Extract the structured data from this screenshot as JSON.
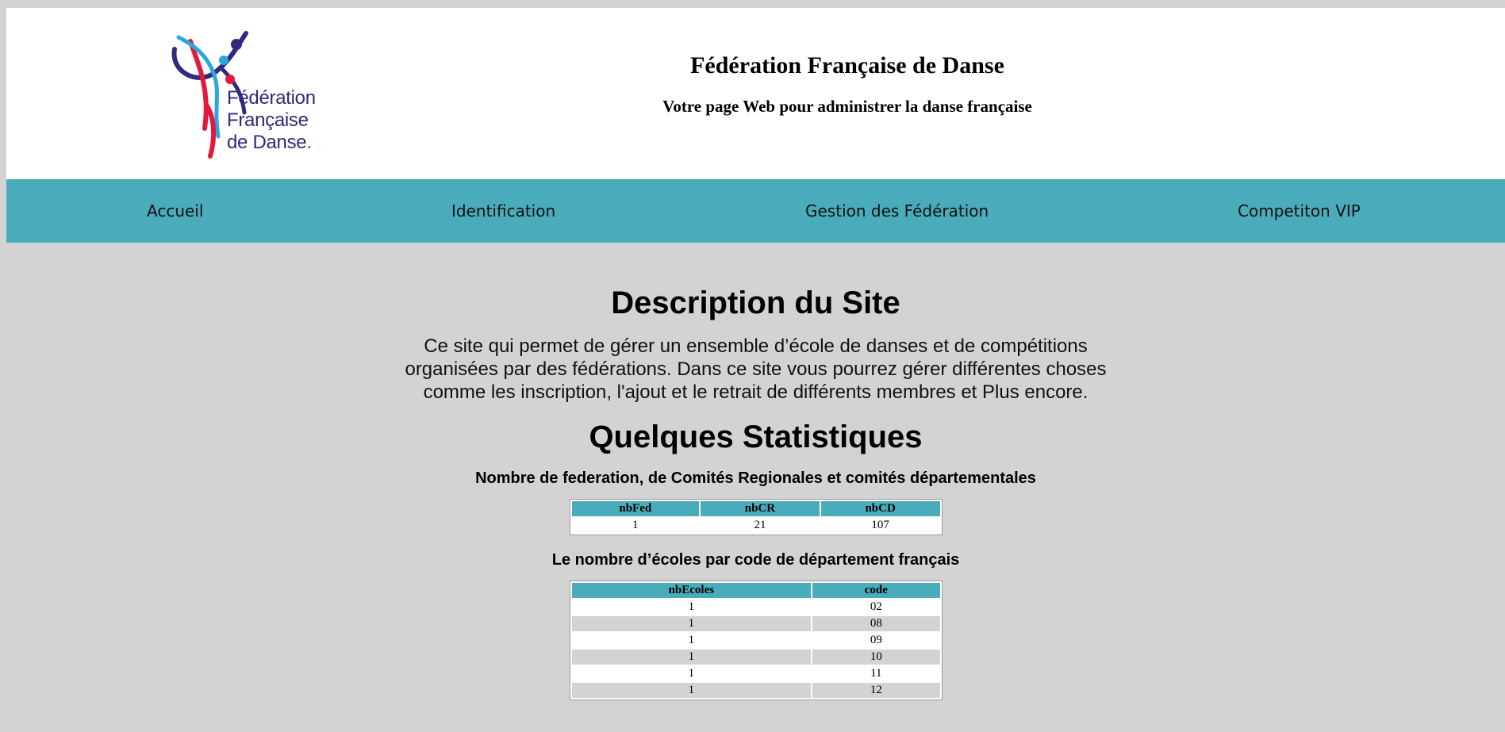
{
  "header": {
    "logo_lines": [
      "Fédération",
      "Française",
      "de Danse"
    ],
    "logo_dot": ".",
    "title": "Fédération Française de Danse",
    "subtitle": "Votre page Web pour administrer la danse française"
  },
  "nav": {
    "items": [
      "Accueil",
      "Identification",
      "Gestion des Fédération",
      "Competiton VIP"
    ]
  },
  "colors": {
    "nav_bg": "#4aabba",
    "page_bg": "#d3d3d3",
    "logo_blue": "#2e2a7c",
    "logo_red": "#e4173c",
    "logo_cyan": "#29a8e0"
  },
  "description": {
    "title": "Description du Site",
    "text": "Ce site qui permet de gérer un ensemble d’école de danses et de compétitions organisées par des fédérations. Dans ce site vous pourrez gérer différentes choses comme les inscription, l'ajout et le retrait de différents membres et Plus encore."
  },
  "stats": {
    "title": "Quelques Statistiques",
    "table1": {
      "caption": "Nombre de federation, de Comités Regionales et comités départementales",
      "headers": [
        "nbFed",
        "nbCR",
        "nbCD"
      ],
      "rows": [
        [
          "1",
          "21",
          "107"
        ]
      ]
    },
    "table2": {
      "caption": "Le nombre d’écoles par code de département français",
      "headers": [
        "nbEcoles",
        "code"
      ],
      "rows": [
        [
          "1",
          "02"
        ],
        [
          "1",
          "08"
        ],
        [
          "1",
          "09"
        ],
        [
          "1",
          "10"
        ],
        [
          "1",
          "11"
        ],
        [
          "1",
          "12"
        ]
      ]
    }
  }
}
